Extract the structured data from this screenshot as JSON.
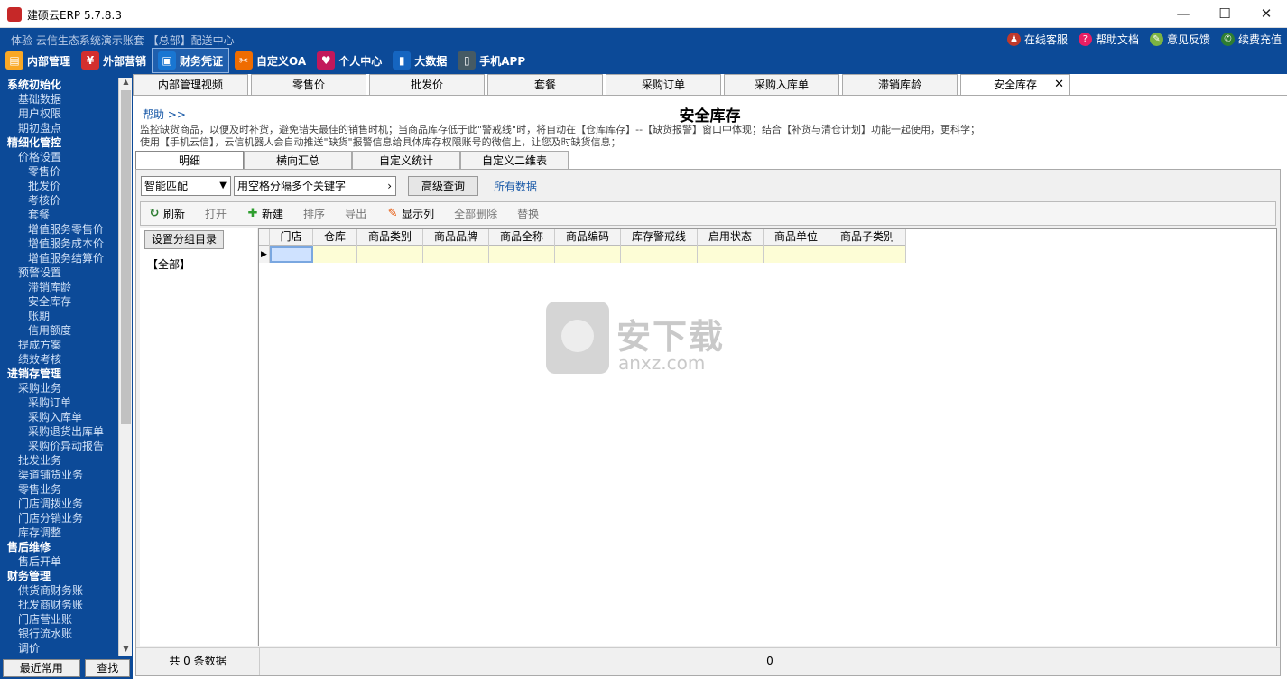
{
  "window": {
    "title": "建硕云ERP  5.7.8.3",
    "min": "—",
    "max": "☐",
    "close": "✕"
  },
  "topbar": {
    "info": "体验 云信生态系统演示账套  【总部】配送中心",
    "links": [
      {
        "label": "在线客服",
        "icon": "service-icon",
        "glyph": "♟",
        "color": "#c0392b"
      },
      {
        "label": "帮助文档",
        "icon": "help-icon",
        "glyph": "?",
        "color": "#e91e63"
      },
      {
        "label": "意见反馈",
        "icon": "feedback-icon",
        "glyph": "✎",
        "color": "#7cb342"
      },
      {
        "label": "续费充值",
        "icon": "wechat-icon",
        "glyph": "✆",
        "color": "#2e7d32"
      }
    ],
    "modules": [
      {
        "label": "内部管理",
        "icon": "books-icon",
        "glyph": "▤",
        "color": "#f9a825"
      },
      {
        "label": "外部营销",
        "icon": "shop-icon",
        "glyph": "¥",
        "color": "#d32f2f"
      },
      {
        "label": "财务凭证",
        "icon": "voucher-icon",
        "glyph": "▣",
        "color": "#1976d2",
        "active": true
      },
      {
        "label": "自定义OA",
        "icon": "tools-icon",
        "glyph": "✂",
        "color": "#ef6c00"
      },
      {
        "label": "个人中心",
        "icon": "heart-icon",
        "glyph": "♥",
        "color": "#c2185b"
      },
      {
        "label": "大数据",
        "icon": "chart-icon",
        "glyph": "▮",
        "color": "#1565c0"
      },
      {
        "label": "手机APP",
        "icon": "phone-icon",
        "glyph": "▯",
        "color": "#455a64"
      }
    ]
  },
  "sidebar": {
    "items": [
      {
        "label": "系统初始化",
        "level": "h"
      },
      {
        "label": "基础数据",
        "level": "l1"
      },
      {
        "label": "用户权限",
        "level": "l1"
      },
      {
        "label": "期初盘点",
        "level": "l1"
      },
      {
        "label": "精细化管控",
        "level": "h"
      },
      {
        "label": "价格设置",
        "level": "l1"
      },
      {
        "label": "零售价",
        "level": "l2"
      },
      {
        "label": "批发价",
        "level": "l2"
      },
      {
        "label": "考核价",
        "level": "l2"
      },
      {
        "label": "套餐",
        "level": "l2"
      },
      {
        "label": "增值服务零售价",
        "level": "l2"
      },
      {
        "label": "增值服务成本价",
        "level": "l2"
      },
      {
        "label": "增值服务结算价",
        "level": "l2"
      },
      {
        "label": "预警设置",
        "level": "l1"
      },
      {
        "label": "滞销库龄",
        "level": "l2"
      },
      {
        "label": "安全库存",
        "level": "l2"
      },
      {
        "label": "账期",
        "level": "l2"
      },
      {
        "label": "信用额度",
        "level": "l2"
      },
      {
        "label": "提成方案",
        "level": "l1"
      },
      {
        "label": "绩效考核",
        "level": "l1"
      },
      {
        "label": "进销存管理",
        "level": "h"
      },
      {
        "label": "采购业务",
        "level": "l1"
      },
      {
        "label": "采购订单",
        "level": "l2"
      },
      {
        "label": "采购入库单",
        "level": "l2"
      },
      {
        "label": "采购退货出库单",
        "level": "l2"
      },
      {
        "label": "采购价异动报告",
        "level": "l2"
      },
      {
        "label": "批发业务",
        "level": "l1"
      },
      {
        "label": "渠道铺货业务",
        "level": "l1"
      },
      {
        "label": "零售业务",
        "level": "l1"
      },
      {
        "label": "门店调拨业务",
        "level": "l1"
      },
      {
        "label": "门店分销业务",
        "level": "l1"
      },
      {
        "label": "库存调整",
        "level": "l1"
      },
      {
        "label": "售后维修",
        "level": "h"
      },
      {
        "label": "售后开单",
        "level": "l1"
      },
      {
        "label": "财务管理",
        "level": "h"
      },
      {
        "label": "供货商财务账",
        "level": "l1"
      },
      {
        "label": "批发商财务账",
        "level": "l1"
      },
      {
        "label": "门店营业账",
        "level": "l1"
      },
      {
        "label": "银行流水账",
        "level": "l1"
      },
      {
        "label": "调价",
        "level": "l1"
      }
    ],
    "recent": "最近常用",
    "find": "查找"
  },
  "tabs": [
    {
      "label": "内部管理视频"
    },
    {
      "label": "零售价"
    },
    {
      "label": "批发价"
    },
    {
      "label": "套餐"
    },
    {
      "label": "采购订单"
    },
    {
      "label": "采购入库单"
    },
    {
      "label": "滞销库龄"
    },
    {
      "label": "安全库存",
      "active": true,
      "close": "✕"
    }
  ],
  "page": {
    "help": "帮助 >>",
    "title": "安全库存",
    "desc1": "监控缺货商品，以便及时补货，避免错失最佳的销售时机；当商品库存低于此\"警戒线\"时，将自动在【仓库库存】--【缺货报警】窗口中体现；结合【补货与清仓计划】功能一起使用，更科学；",
    "desc2": "使用【手机云信】，云信机器人会自动推送\"缺货\"报警信息给具体库存权限账号的微信上，让您及时缺货信息；"
  },
  "subtabs": [
    "明细",
    "横向汇总",
    "自定义统计",
    "自定义二维表"
  ],
  "search": {
    "mode": "智能匹配",
    "placeholder": "用空格分隔多个关键字",
    "advanced": "高级查询",
    "all": "所有数据"
  },
  "toolbar": {
    "refresh": "刷新",
    "open": "打开",
    "new": "新建",
    "sort": "排序",
    "export": "导出",
    "columns": "显示列",
    "delete_all": "全部删除",
    "replace": "替换"
  },
  "groups": {
    "set_button": "设置分组目录",
    "all": "【全部】"
  },
  "grid": {
    "columns": [
      "门店",
      "仓库",
      "商品类别",
      "商品品牌",
      "商品全称",
      "商品编码",
      "库存警戒线",
      "启用状态",
      "商品单位",
      "商品子类别"
    ]
  },
  "footer": {
    "count": "共 0 条数据",
    "sum": "0"
  },
  "watermark": {
    "text": "安下载",
    "url": "anxz.com"
  }
}
